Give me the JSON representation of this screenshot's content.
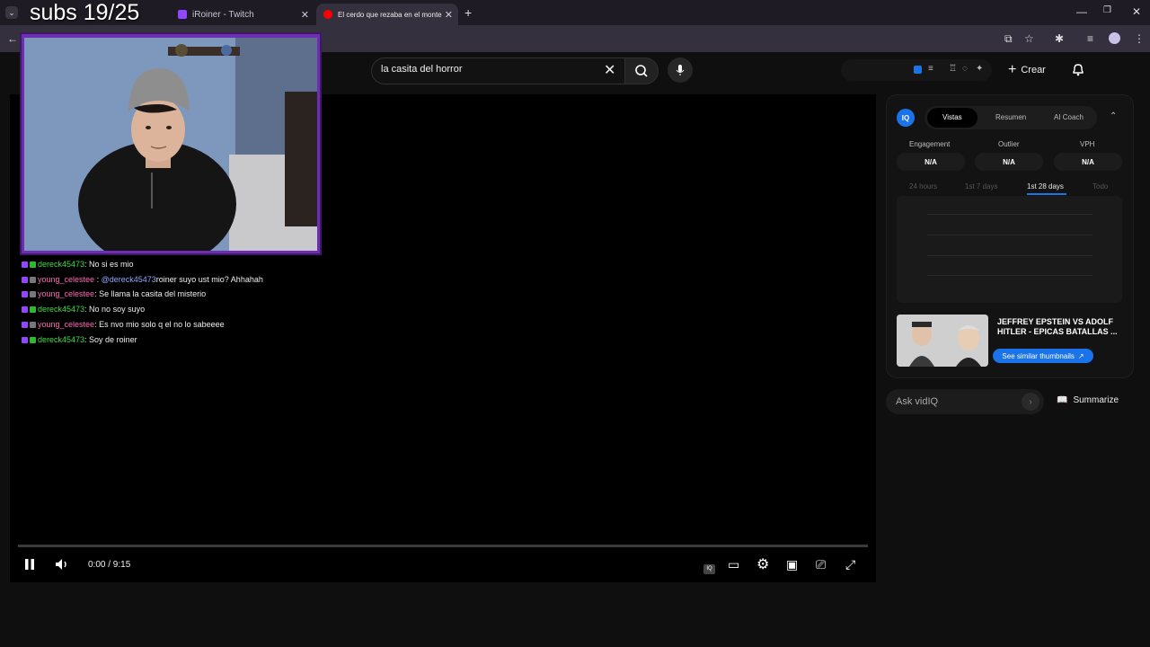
{
  "browser": {
    "tabs": [
      {
        "label": "",
        "active": false
      },
      {
        "label": "iRoiner - Twitch",
        "active": false
      },
      {
        "label": "El cerdo que rezaba en el monte",
        "active": true
      }
    ],
    "new_tab": "+",
    "close_glyph": "✕"
  },
  "overlay": {
    "subs_counter": "subs 19/25"
  },
  "chat": [
    {
      "user": "dereck45473",
      "color": "green",
      "mention": "",
      "message": " : No si es mio"
    },
    {
      "user": "young_celestee",
      "color": "pink",
      "mention": "@dereck45473",
      "message": " roiner suyo ust mio? Ahhahah"
    },
    {
      "user": "young_celestee",
      "color": "pink",
      "mention": "",
      "message": " : Se llama la casita del misterio"
    },
    {
      "user": "dereck45473",
      "color": "green",
      "mention": "",
      "message": " : No no soy suyo"
    },
    {
      "user": "young_celestee",
      "color": "pink",
      "mention": "",
      "message": " : Es nvo mio solo q el no lo sabeeee"
    },
    {
      "user": "dereck45473",
      "color": "green",
      "mention": "",
      "message": " : Soy de roiner"
    }
  ],
  "youtube": {
    "search_query": "la casita del horror",
    "create_label": "Crear"
  },
  "player": {
    "time": "0:00 / 9:15",
    "progress": 0
  },
  "vidiq": {
    "logo": "IQ",
    "tabs": [
      "Vistas",
      "Resumen",
      "AI Coach"
    ],
    "metrics": [
      {
        "label": "Engagement",
        "value": "N/A"
      },
      {
        "label": "Outlier",
        "value": "N/A"
      },
      {
        "label": "VPH",
        "value": "N/A"
      }
    ],
    "ranges": [
      "24 hours",
      "1st 7 days",
      "1st 28 days",
      "Todo"
    ],
    "video_title": "JEFFREY EPSTEIN VS ADOLF HITLER - EPICAS BATALLAS ...",
    "similar_btn": "See similar thumbnails",
    "ask_placeholder": "Ask vidIQ",
    "summarize_label": "Summarize"
  },
  "colors": {
    "accent": "#1a73e8",
    "cam_frame": "#6b2fb0",
    "chat_green": "#3ede3e",
    "chat_pink": "#ff69b4"
  }
}
